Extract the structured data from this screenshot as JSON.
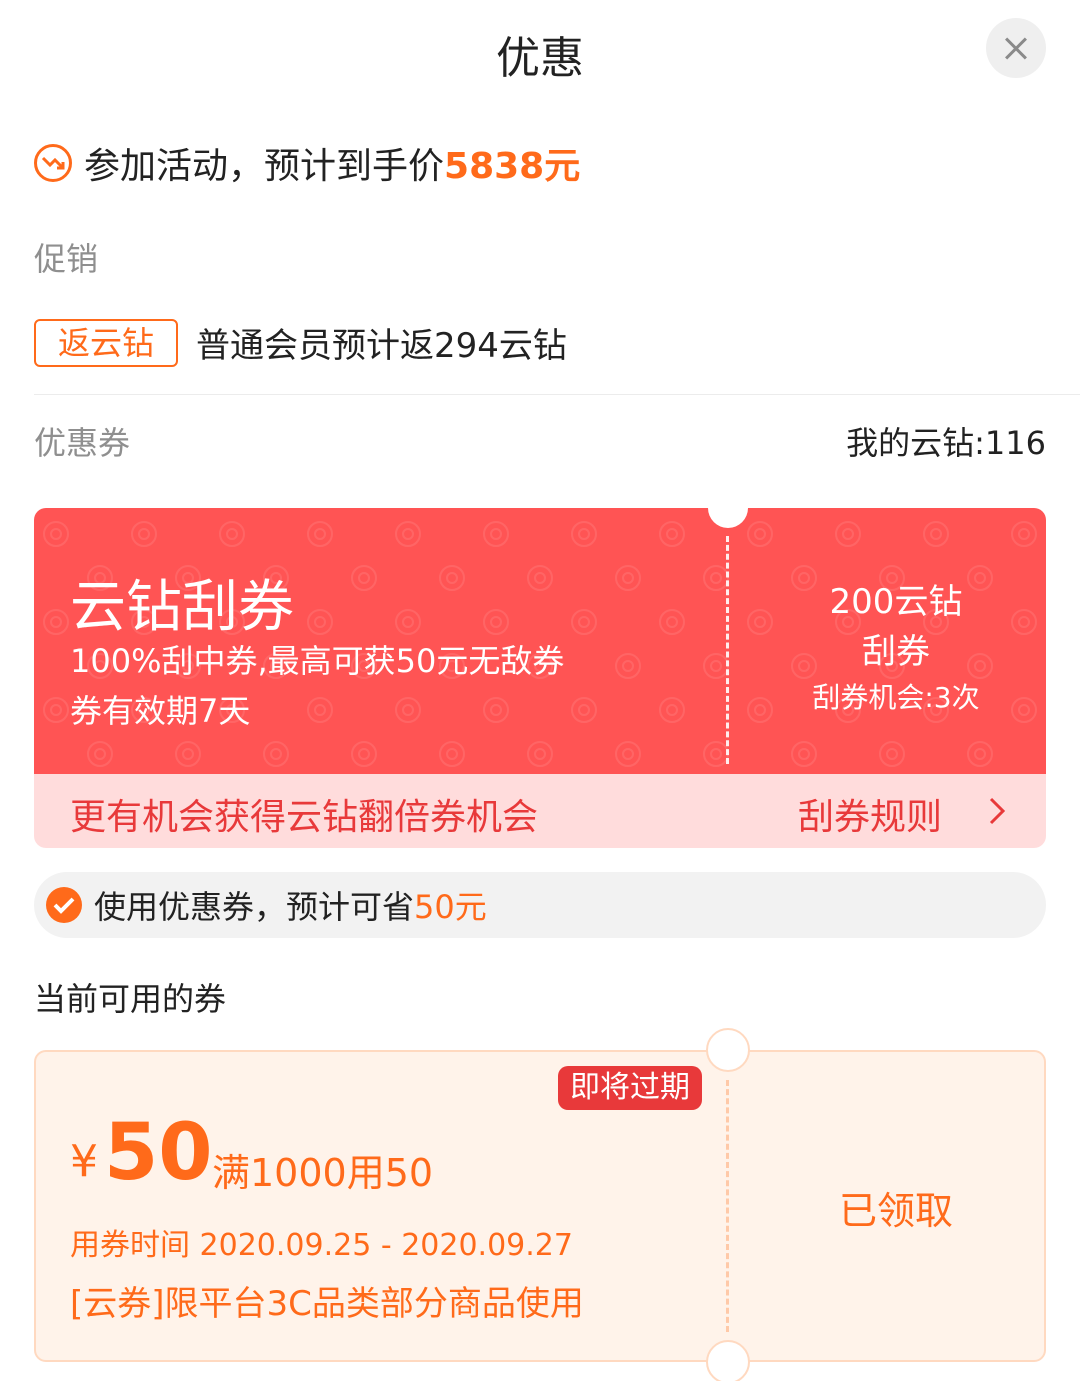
{
  "header": {
    "title": "优惠",
    "close_icon": "close-icon"
  },
  "activity": {
    "icon": "price-down-icon",
    "text": "参加活动，预计到手价",
    "price": "5838元"
  },
  "promotion": {
    "label": "促销",
    "tag": "返云钻",
    "text": "普通会员预计返294云钻"
  },
  "coupons_section": {
    "label": "优惠券",
    "my_coins": "我的云钻:116"
  },
  "scratch_card": {
    "title": "云钻刮券",
    "desc1": "100%刮中券,最高可获50元无敌券",
    "desc2": "券有效期7天",
    "cost": "200云钻",
    "action": "刮券",
    "chances": "刮券机会:3次",
    "more": "更有机会获得云钻翻倍券机会",
    "rules": "刮券规则",
    "colors": {
      "main": "#ff5454",
      "bottom": "#ffdcdc",
      "text": "#e8393a"
    }
  },
  "use_coupon": {
    "checked": true,
    "text": "使用优惠券，预计可省",
    "amount": "50元"
  },
  "available": {
    "title": "当前可用的券",
    "coupons": [
      {
        "badge": "即将过期",
        "currency": "¥",
        "value": "50",
        "condition": "满1000用50",
        "time": "用券时间 2020.09.25 - 2020.09.27",
        "scope": "[云券]限平台3C品类部分商品使用",
        "action": "已领取"
      }
    ]
  },
  "accent_color": "#ff6a1a"
}
